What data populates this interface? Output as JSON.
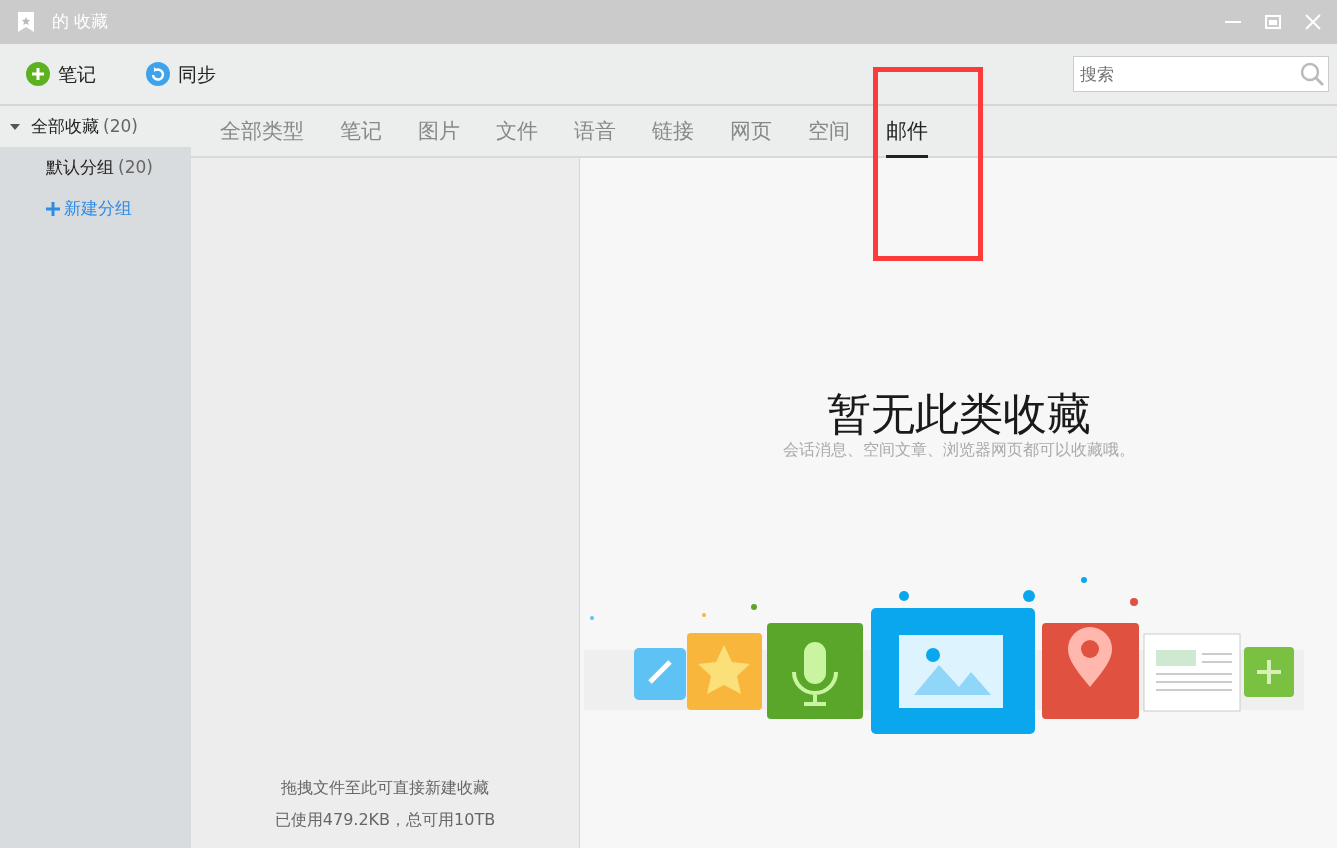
{
  "window": {
    "title": "的 收藏"
  },
  "toolbar": {
    "buttons": [
      {
        "kind": "note",
        "label": "笔记"
      },
      {
        "kind": "sync",
        "label": "同步"
      }
    ],
    "search": {
      "placeholder": "搜索"
    }
  },
  "sidebar": {
    "items": [
      {
        "label": "全部收藏",
        "count": "(20)",
        "selected": true,
        "expanded": true,
        "children": [
          {
            "label": "默认分组",
            "count": "(20)",
            "selected": false
          }
        ]
      }
    ],
    "new_group": "新建分组"
  },
  "tabs": [
    {
      "label": "全部类型",
      "selected": false
    },
    {
      "label": "笔记",
      "selected": false
    },
    {
      "label": "图片",
      "selected": false
    },
    {
      "label": "文件",
      "selected": false
    },
    {
      "label": "语音",
      "selected": false
    },
    {
      "label": "链接",
      "selected": false
    },
    {
      "label": "网页",
      "selected": false
    },
    {
      "label": "空间",
      "selected": false
    },
    {
      "label": "邮件",
      "selected": true
    }
  ],
  "list_pane": {
    "hint": "拖拽文件至此可直接新建收藏",
    "usage": "已使用479.2KB，总可用10TB"
  },
  "empty_state": {
    "title": "暂无此类收藏",
    "subtitle": "会话消息、空间文章、浏览器网页都可以收藏哦。"
  }
}
